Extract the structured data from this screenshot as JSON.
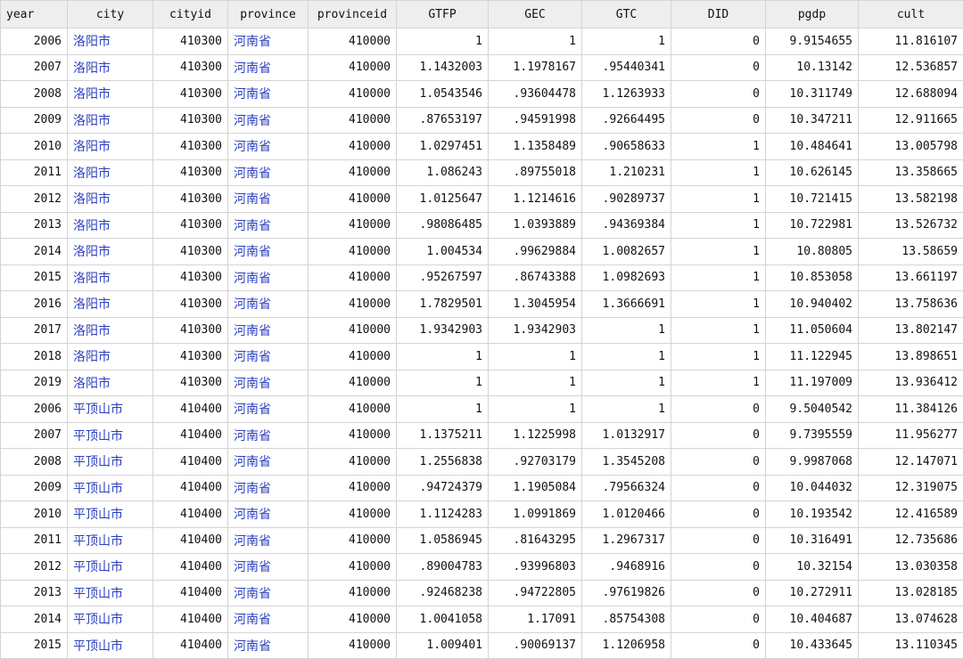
{
  "table": {
    "columns": [
      {
        "key": "year",
        "label": "year",
        "type": "num",
        "width": 75
      },
      {
        "key": "city",
        "label": "city",
        "type": "str",
        "width": 96
      },
      {
        "key": "cityid",
        "label": "cityid",
        "type": "num",
        "width": 84
      },
      {
        "key": "province",
        "label": "province",
        "type": "str",
        "width": 90
      },
      {
        "key": "provinceid",
        "label": "provinceid",
        "type": "num",
        "width": 99
      },
      {
        "key": "GTFP",
        "label": "GTFP",
        "type": "num",
        "width": 103
      },
      {
        "key": "GEC",
        "label": "GEC",
        "type": "num",
        "width": 105
      },
      {
        "key": "GTC",
        "label": "GTC",
        "type": "num",
        "width": 100
      },
      {
        "key": "DID",
        "label": "DID",
        "type": "num",
        "width": 106
      },
      {
        "key": "pgdp",
        "label": "pgdp",
        "type": "num",
        "width": 104
      },
      {
        "key": "cult",
        "label": "cult",
        "type": "num",
        "width": 118
      }
    ],
    "rows": [
      [
        "2006",
        "洛阳市",
        "410300",
        "河南省",
        "410000",
        "1",
        "1",
        "1",
        "0",
        "9.9154655",
        "11.816107"
      ],
      [
        "2007",
        "洛阳市",
        "410300",
        "河南省",
        "410000",
        "1.1432003",
        "1.1978167",
        ".95440341",
        "0",
        "10.13142",
        "12.536857"
      ],
      [
        "2008",
        "洛阳市",
        "410300",
        "河南省",
        "410000",
        "1.0543546",
        ".93604478",
        "1.1263933",
        "0",
        "10.311749",
        "12.688094"
      ],
      [
        "2009",
        "洛阳市",
        "410300",
        "河南省",
        "410000",
        ".87653197",
        ".94591998",
        ".92664495",
        "0",
        "10.347211",
        "12.911665"
      ],
      [
        "2010",
        "洛阳市",
        "410300",
        "河南省",
        "410000",
        "1.0297451",
        "1.1358489",
        ".90658633",
        "1",
        "10.484641",
        "13.005798"
      ],
      [
        "2011",
        "洛阳市",
        "410300",
        "河南省",
        "410000",
        "1.086243",
        ".89755018",
        "1.210231",
        "1",
        "10.626145",
        "13.358665"
      ],
      [
        "2012",
        "洛阳市",
        "410300",
        "河南省",
        "410000",
        "1.0125647",
        "1.1214616",
        ".90289737",
        "1",
        "10.721415",
        "13.582198"
      ],
      [
        "2013",
        "洛阳市",
        "410300",
        "河南省",
        "410000",
        ".98086485",
        "1.0393889",
        ".94369384",
        "1",
        "10.722981",
        "13.526732"
      ],
      [
        "2014",
        "洛阳市",
        "410300",
        "河南省",
        "410000",
        "1.004534",
        ".99629884",
        "1.0082657",
        "1",
        "10.80805",
        "13.58659"
      ],
      [
        "2015",
        "洛阳市",
        "410300",
        "河南省",
        "410000",
        ".95267597",
        ".86743388",
        "1.0982693",
        "1",
        "10.853058",
        "13.661197"
      ],
      [
        "2016",
        "洛阳市",
        "410300",
        "河南省",
        "410000",
        "1.7829501",
        "1.3045954",
        "1.3666691",
        "1",
        "10.940402",
        "13.758636"
      ],
      [
        "2017",
        "洛阳市",
        "410300",
        "河南省",
        "410000",
        "1.9342903",
        "1.9342903",
        "1",
        "1",
        "11.050604",
        "13.802147"
      ],
      [
        "2018",
        "洛阳市",
        "410300",
        "河南省",
        "410000",
        "1",
        "1",
        "1",
        "1",
        "11.122945",
        "13.898651"
      ],
      [
        "2019",
        "洛阳市",
        "410300",
        "河南省",
        "410000",
        "1",
        "1",
        "1",
        "1",
        "11.197009",
        "13.936412"
      ],
      [
        "2006",
        "平顶山市",
        "410400",
        "河南省",
        "410000",
        "1",
        "1",
        "1",
        "0",
        "9.5040542",
        "11.384126"
      ],
      [
        "2007",
        "平顶山市",
        "410400",
        "河南省",
        "410000",
        "1.1375211",
        "1.1225998",
        "1.0132917",
        "0",
        "9.7395559",
        "11.956277"
      ],
      [
        "2008",
        "平顶山市",
        "410400",
        "河南省",
        "410000",
        "1.2556838",
        ".92703179",
        "1.3545208",
        "0",
        "9.9987068",
        "12.147071"
      ],
      [
        "2009",
        "平顶山市",
        "410400",
        "河南省",
        "410000",
        ".94724379",
        "1.1905084",
        ".79566324",
        "0",
        "10.044032",
        "12.319075"
      ],
      [
        "2010",
        "平顶山市",
        "410400",
        "河南省",
        "410000",
        "1.1124283",
        "1.0991869",
        "1.0120466",
        "0",
        "10.193542",
        "12.416589"
      ],
      [
        "2011",
        "平顶山市",
        "410400",
        "河南省",
        "410000",
        "1.0586945",
        ".81643295",
        "1.2967317",
        "0",
        "10.316491",
        "12.735686"
      ],
      [
        "2012",
        "平顶山市",
        "410400",
        "河南省",
        "410000",
        ".89004783",
        ".93996803",
        ".9468916",
        "0",
        "10.32154",
        "13.030358"
      ],
      [
        "2013",
        "平顶山市",
        "410400",
        "河南省",
        "410000",
        ".92468238",
        ".94722805",
        ".97619826",
        "0",
        "10.272911",
        "13.028185"
      ],
      [
        "2014",
        "平顶山市",
        "410400",
        "河南省",
        "410000",
        "1.0041058",
        "1.17091",
        ".85754308",
        "0",
        "10.404687",
        "13.074628"
      ],
      [
        "2015",
        "平顶山市",
        "410400",
        "河南省",
        "410000",
        "1.009401",
        ".90069137",
        "1.1206958",
        "0",
        "10.433645",
        "13.110345"
      ]
    ]
  }
}
